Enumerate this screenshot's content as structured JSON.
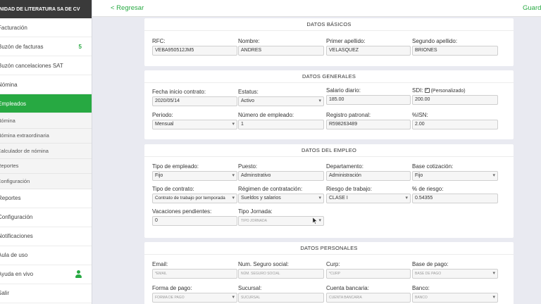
{
  "sidebar": {
    "company": "UNIDAD DE LITERATURA SA DE CV",
    "items": [
      {
        "label": "Facturación",
        "badge": ""
      },
      {
        "label": "Buzón de facturas",
        "badge": "5"
      },
      {
        "label": "Buzón cancelaciones SAT",
        "badge": ""
      },
      {
        "label": "Nómina",
        "badge": ""
      },
      {
        "label": "Empleados",
        "badge": ""
      }
    ],
    "subitems": [
      "Nómina",
      "Nómina extraordinaria",
      "Calculador de nómina",
      "Reportes",
      "Configuración"
    ],
    "bottom_items": [
      {
        "label": "Reportes"
      },
      {
        "label": "Configuración"
      },
      {
        "label": "Notificaciones"
      },
      {
        "label": "Aula de uso"
      },
      {
        "label": "Ayuda en vivo"
      },
      {
        "label": "Salir"
      }
    ]
  },
  "topbar": {
    "back": "< Regresar",
    "save": "Guardar"
  },
  "basicos": {
    "title": "DATOS BÁSICOS",
    "rfc_label": "RFC:",
    "rfc": "VEBA950512JM5",
    "nombre_label": "Nombre:",
    "nombre": "ANDRES",
    "ap1_label": "Primer apellido:",
    "ap1": "VELASQUEZ",
    "ap2_label": "Segundo apellido:",
    "ap2": "BRIONES"
  },
  "generales": {
    "title": "DATOS GENERALES",
    "fecha_label": "Fecha inicio contrato:",
    "fecha": "2020/05/14",
    "estatus_label": "Estatus:",
    "estatus": "Activo",
    "salario_label": "Salario diario:",
    "salario": "185.00",
    "sdi_label": "SDI:",
    "sdi_check": "✓",
    "sdi_note": "(Personalizado)",
    "sdi": "200.00",
    "periodo_label": "Periodo:",
    "periodo": "Mensual",
    "numemp_label": "Número de empleado:",
    "numemp": "1",
    "registro_label": "Registro patronal:",
    "registro": "R598263489",
    "isn_label": "%ISN:",
    "isn": "2.00"
  },
  "empleo": {
    "title": "DATOS DEL EMPLEO",
    "tipo_label": "Tipo de empleado:",
    "tipo": "Fijo",
    "puesto_label": "Puesto:",
    "puesto": "Adminstrativo",
    "depto_label": "Departamento:",
    "depto": "Administración",
    "base_label": "Base cotización:",
    "base": "Fijo",
    "contrato_label": "Tipo de contrato:",
    "contrato": "Contrato de trabajo por temporada",
    "regimen_label": "Régimen de contratación:",
    "regimen": "Sueldos y salarios",
    "riesgo_label": "Riesgo de trabajo:",
    "riesgo": "CLASE I",
    "pct_riesgo_label": "% de riesgo:",
    "pct_riesgo": "0.54355",
    "vacaciones_label": "Vacaciones pendientes:",
    "vacaciones": "0",
    "jornada_label": "Tipo Jornada:",
    "jornada_placeholder": "TIPO JORNADA"
  },
  "personales": {
    "title": "DATOS PERSONALES",
    "email_label": "Email:",
    "email_placeholder": "*EMAIL",
    "nss_label": "Num. Seguro social:",
    "nss_placeholder": "NÚM. SEGURO SOCIAL",
    "curp_label": "Curp:",
    "curp_placeholder": "*CURP",
    "basepago_label": "Base de pago:",
    "basepago_placeholder": "BASE DE PAGO",
    "formapago_label": "Forma de pago:",
    "formapago_placeholder": "FORMA DE PAGO",
    "sucursal_label": "Sucursal:",
    "sucursal_placeholder": "SUCURSAL",
    "cuenta_label": "Cuenta bancaria:",
    "cuenta_placeholder": "CUENTA BANCARIA",
    "banco_label": "Banco:",
    "banco_placeholder": "BANCO"
  },
  "colors": {
    "accent": "#27a942",
    "header": "#3a3a3a",
    "background": "#e9eaf1"
  }
}
